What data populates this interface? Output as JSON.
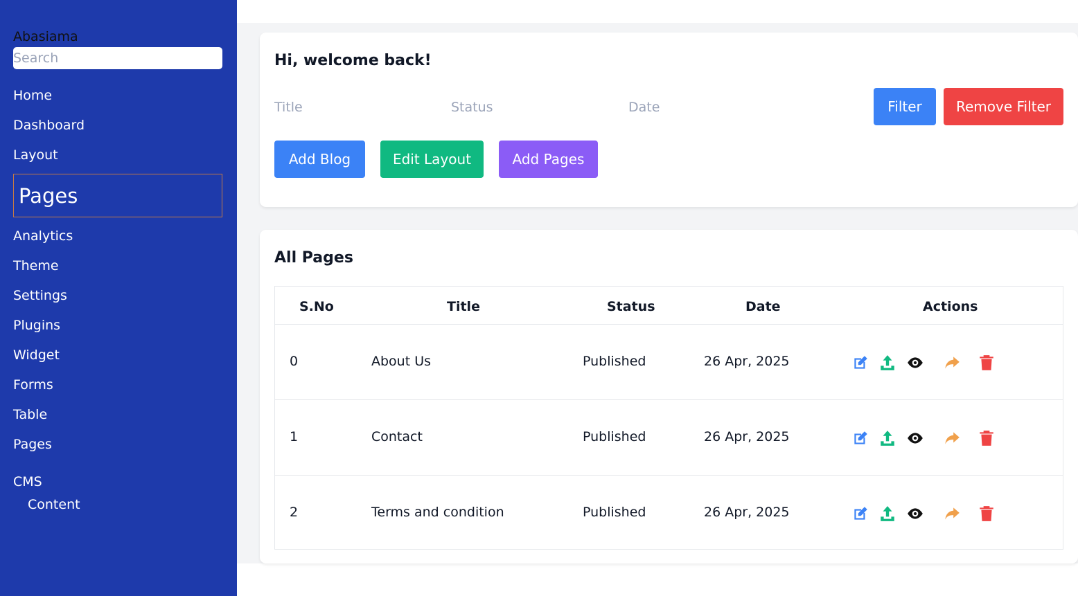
{
  "sidebar": {
    "brand": "Abasiama",
    "search_placeholder": "Search",
    "items": [
      {
        "label": "Home"
      },
      {
        "label": "Dashboard"
      },
      {
        "label": "Layout"
      },
      {
        "label": "Pages"
      },
      {
        "label": "Analytics"
      },
      {
        "label": "Theme"
      },
      {
        "label": "Settings"
      },
      {
        "label": "Plugins"
      },
      {
        "label": "Widget"
      },
      {
        "label": "Forms"
      },
      {
        "label": "Table"
      },
      {
        "label": "Pages"
      },
      {
        "label": "CMS"
      },
      {
        "label": "Content"
      }
    ]
  },
  "header": {
    "welcome": "Hi, welcome back!",
    "filters": {
      "title": "Title",
      "status": "Status",
      "date": "Date"
    },
    "filter_button": "Filter",
    "remove_filter_button": "Remove Filter",
    "add_blog_button": "Add Blog",
    "edit_layout_button": "Edit Layout",
    "add_pages_button": "Add Pages"
  },
  "table": {
    "title": "All Pages",
    "columns": [
      "S.No",
      "Title",
      "Status",
      "Date",
      "Actions"
    ],
    "rows": [
      {
        "sno": "0",
        "title": "About Us",
        "status": "Published",
        "date": "26 Apr, 2025"
      },
      {
        "sno": "1",
        "title": "Contact",
        "status": "Published",
        "date": "26 Apr, 2025"
      },
      {
        "sno": "2",
        "title": "Terms and condition",
        "status": "Published",
        "date": "26 Apr, 2025"
      }
    ],
    "action_icons": [
      "edit-icon",
      "upload-icon",
      "eye-icon",
      "share-icon",
      "trash-icon"
    ]
  },
  "colors": {
    "sidebar": "#1e3aab",
    "filter": "#3b82f6",
    "remove_filter": "#ef4444",
    "add_blog": "#3b82f6",
    "edit_layout": "#10b981",
    "add_pages": "#8b5cf6",
    "edit_icon": "#3b82f6",
    "upload_icon": "#10b981",
    "eye_icon": "#111111",
    "share_icon": "#f0a04b",
    "trash_icon": "#ef4444"
  }
}
